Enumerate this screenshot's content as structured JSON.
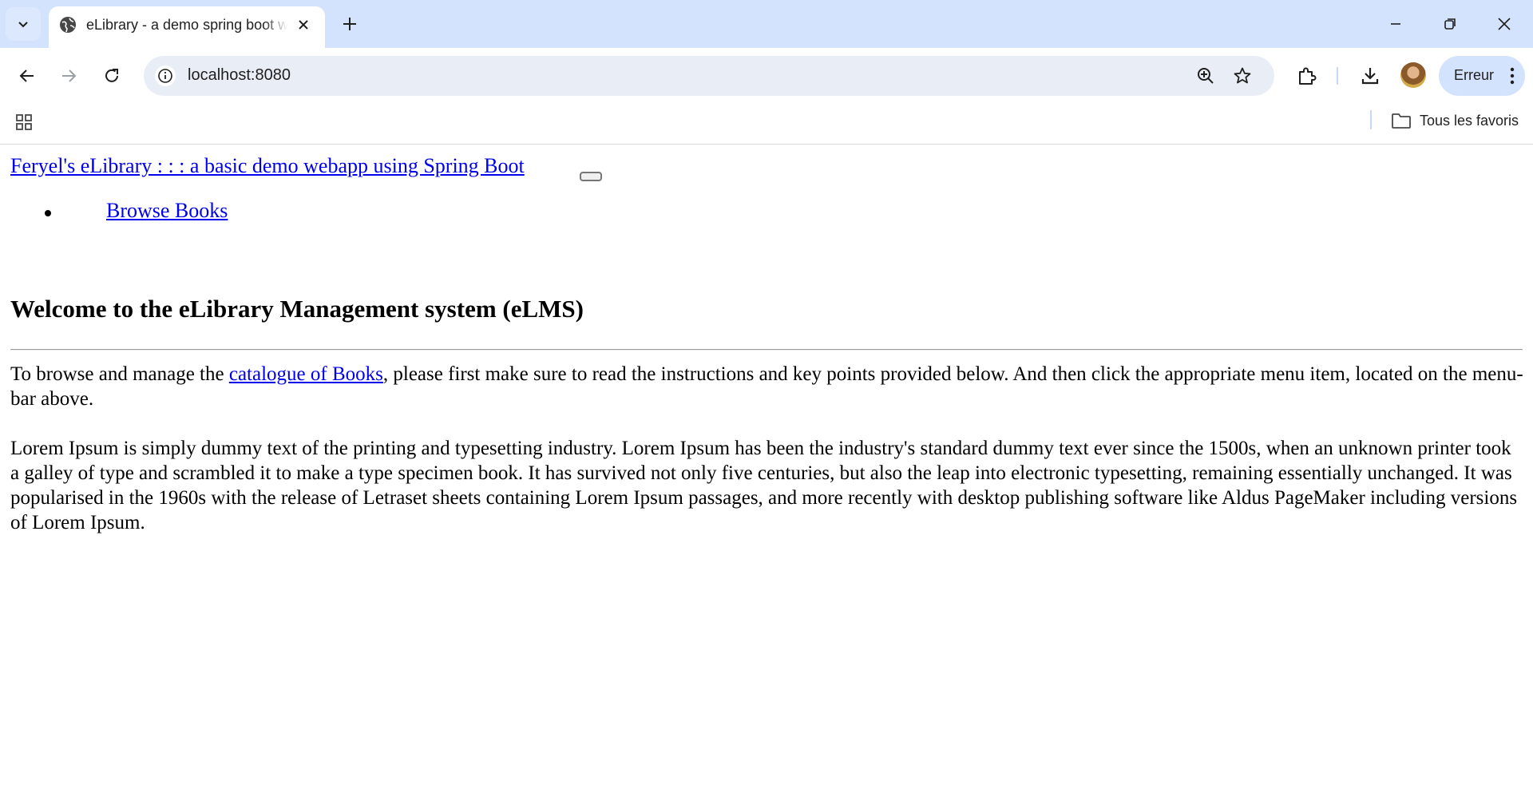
{
  "browser": {
    "tab": {
      "title": "eLibrary - a demo spring boot webapp"
    },
    "address_bar": {
      "url": "localhost:8080"
    },
    "profile_button": {
      "label": "Erreur"
    },
    "bookmarks_bar": {
      "all_bookmarks_label": "Tous les favoris"
    }
  },
  "page": {
    "brand": "Feryel's eLibrary : : : a basic demo webapp using Spring Boot",
    "nav": [
      {
        "label": "Browse Books"
      }
    ],
    "heading": "Welcome to the eLibrary Management system (eLMS)",
    "intro": {
      "before": "To browse and manage the ",
      "link": "catalogue of Books",
      "after": ", please first make sure to read the instructions and key points provided below. And then click the appropriate menu item, located on the menu-bar above."
    },
    "lorem": "Lorem Ipsum is simply dummy text of the printing and typesetting industry. Lorem Ipsum has been the industry's standard dummy text ever since the 1500s, when an unknown printer took a galley of type and scrambled it to make a type specimen book. It has survived not only five centuries, but also the leap into electronic typesetting, remaining essentially unchanged. It was popularised in the 1960s with the release of Letraset sheets containing Lorem Ipsum passages, and more recently with desktop publishing software like Aldus PageMaker including versions of Lorem Ipsum."
  },
  "colors": {
    "chrome_bg": "#d3e3fd",
    "omnibox_bg": "#e9eef6",
    "link": "#0000ee"
  }
}
